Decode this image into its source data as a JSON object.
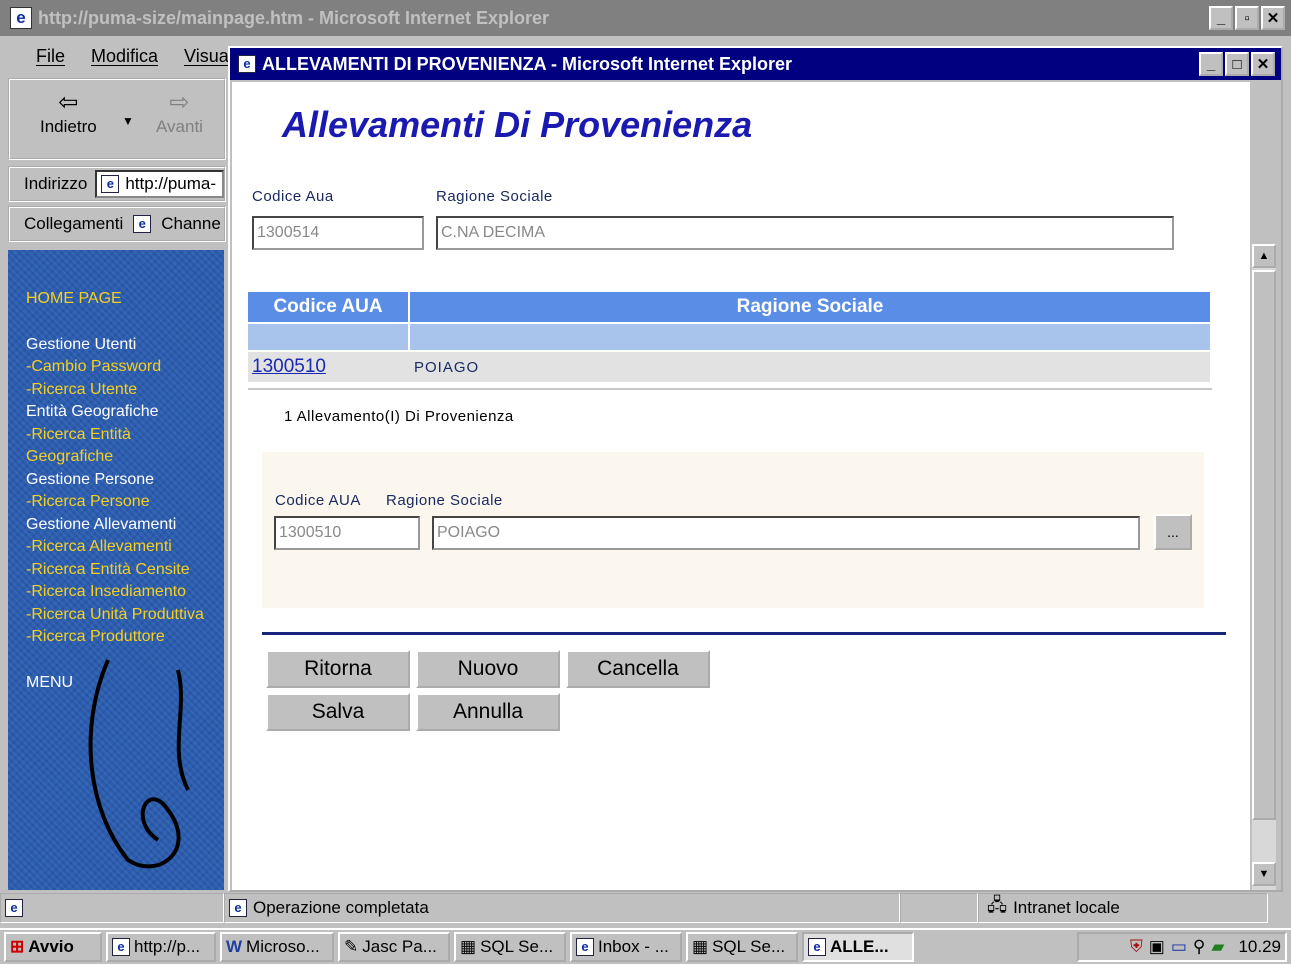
{
  "browser": {
    "title": "http://puma-size/mainpage.htm - Microsoft Internet Explorer",
    "menu": [
      "File",
      "Modifica",
      "Visual"
    ],
    "back_label": "Indietro",
    "forward_label": "Avanti",
    "address_label": "Indirizzo",
    "address_value": "http://puma-",
    "links_label": "Collegamenti",
    "channels_label": "Channe"
  },
  "sidebar": {
    "home": "HOME PAGE",
    "items": [
      {
        "label": "Gestione Utenti",
        "kind": "header"
      },
      {
        "label": "-Cambio Password",
        "kind": "link"
      },
      {
        "label": "-Ricerca Utente",
        "kind": "link"
      },
      {
        "label": "Entità Geografiche",
        "kind": "header"
      },
      {
        "label": "-Ricerca Entità",
        "kind": "link"
      },
      {
        "label": "Geografiche",
        "kind": "link"
      },
      {
        "label": "Gestione Persone",
        "kind": "header"
      },
      {
        "label": "-Ricerca Persone",
        "kind": "link"
      },
      {
        "label": "Gestione Allevamenti",
        "kind": "header"
      },
      {
        "label": "-Ricerca Allevamenti",
        "kind": "link"
      },
      {
        "label": "-Ricerca Entità Censite",
        "kind": "link"
      },
      {
        "label": "-Ricerca Insediamento",
        "kind": "link"
      },
      {
        "label": "-Ricerca Unità Produttiva",
        "kind": "link"
      },
      {
        "label": "-Ricerca Produttore",
        "kind": "link"
      }
    ],
    "menu": "MENU"
  },
  "popup": {
    "title": "ALLEVAMENTI DI PROVENIENZA - Microsoft Internet Explorer",
    "heading": "Allevamenti Di Provenienza",
    "filter": {
      "codice_label": "Codice Aua",
      "ragione_label": "Ragione Sociale",
      "codice_value": "1300514",
      "ragione_value": "C.NA DECIMA"
    },
    "table": {
      "headers": [
        "Codice AUA",
        "Ragione Sociale"
      ],
      "rows": [
        {
          "codice": "1300510",
          "ragione": "POIAGO"
        }
      ]
    },
    "count_text": "1 Allevamento(I) Di Provenienza",
    "detail": {
      "codice_label": "Codice AUA",
      "ragione_label": "Ragione Sociale",
      "codice_value": "1300510",
      "ragione_value": "POIAGO",
      "browse_label": "..."
    },
    "buttons": {
      "ritorna": "Ritorna",
      "nuovo": "Nuovo",
      "cancella": "Cancella",
      "salva": "Salva",
      "annulla": "Annulla"
    },
    "status": "Operazione completata",
    "zone": "Intranet locale"
  },
  "taskbar": {
    "start": "Avvio",
    "items": [
      "http://p...",
      "Microso...",
      "Jasc Pa...",
      "SQL Se...",
      "Inbox - ...",
      "SQL Se...",
      "ALLE..."
    ],
    "clock": "10.29"
  }
}
